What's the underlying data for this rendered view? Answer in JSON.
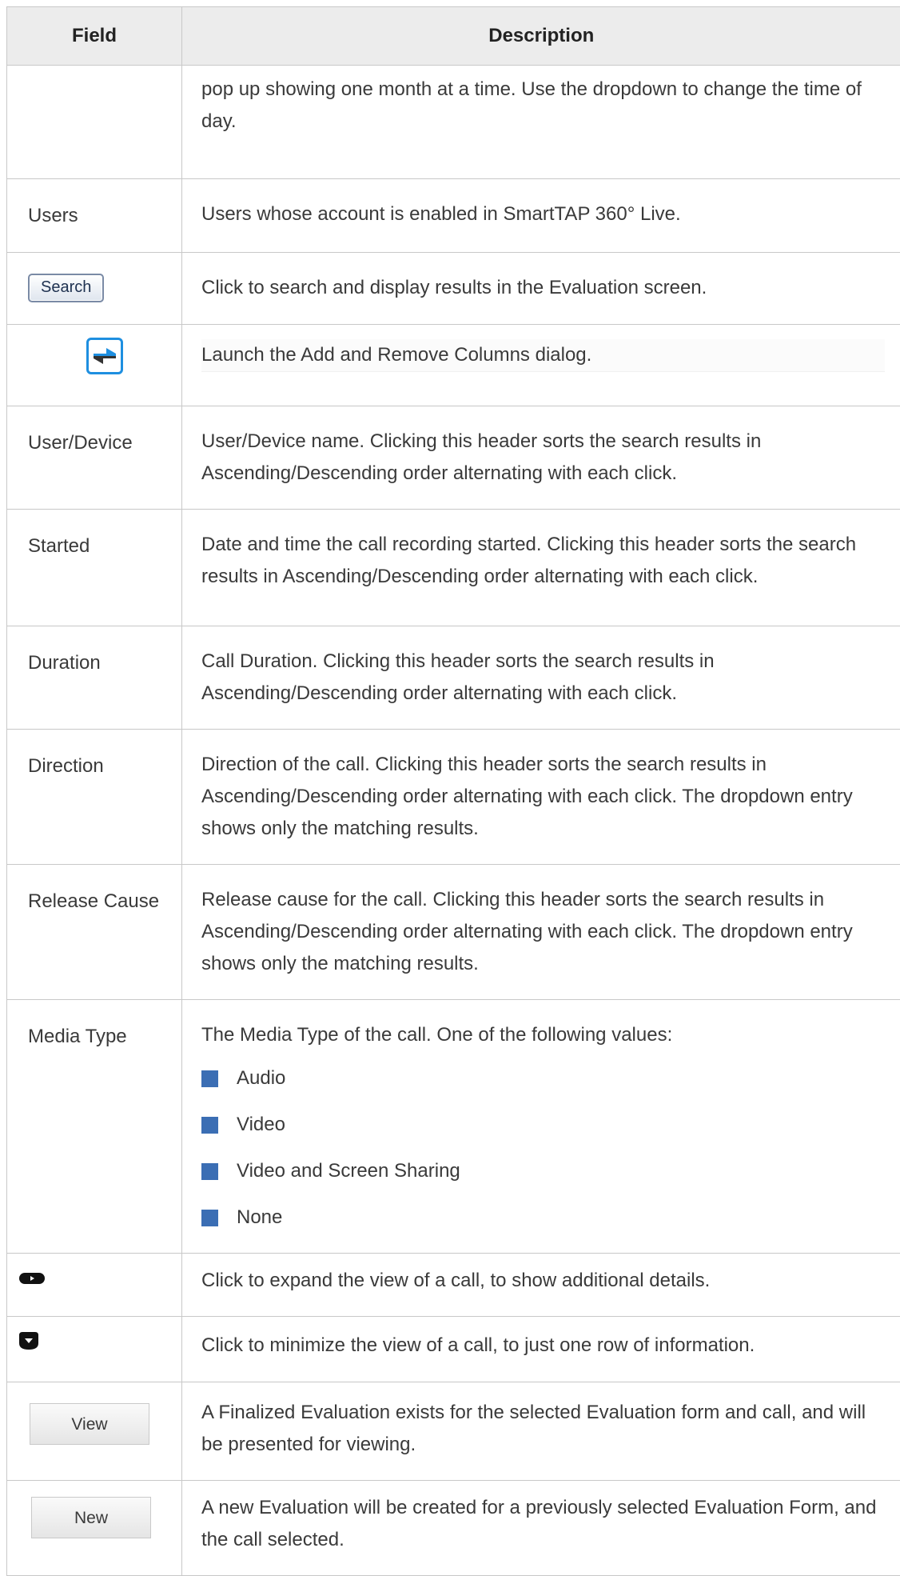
{
  "header": {
    "field": "Field",
    "description": "Description"
  },
  "rows": [
    {
      "field": "",
      "description": "pop up showing one month at a time. Use the dropdown to change the time of day."
    },
    {
      "field": "Users",
      "description": "Users whose account is enabled in SmartTAP 360° Live."
    },
    {
      "field_button": "Search",
      "description": "Click to search and display results in the Evaluation screen."
    },
    {
      "field_icon": "swap-columns-icon",
      "description": "Launch the Add and Remove Columns dialog."
    },
    {
      "field": "User/Device",
      "description": "User/Device name. Clicking this header sorts the search results in Ascending/Descending order alternating with each click."
    },
    {
      "field": "Started",
      "description": "Date and time the call recording started. Clicking this header sorts the search results in Ascending/Descending order alternating with each click."
    },
    {
      "field": "Duration",
      "description": "Call Duration. Clicking this header sorts the search results in Ascending/Descending order alternating with each click."
    },
    {
      "field": "Direction",
      "description": "Direction of the call. Clicking this header sorts the search results in Ascending/Descending order alternating with each click. The dropdown entry shows only the matching results."
    },
    {
      "field": "Release Cause",
      "description": "Release cause for the call. Clicking this header sorts the search results in Ascending/Descending order alternating with each click. The dropdown entry shows only the matching results."
    },
    {
      "field": "Media Type",
      "description": "The Media Type of the call. One of the following values:",
      "bullets": [
        "Audio",
        "Video",
        "Video and Screen Sharing",
        "None"
      ]
    },
    {
      "field_icon": "expand-icon",
      "description": "Click to expand the view of a call, to show additional details."
    },
    {
      "field_icon": "collapse-icon",
      "description": "Click to minimize the view of a call, to just one row of information."
    },
    {
      "field_button": "View",
      "description": "A Finalized Evaluation exists for the selected Evaluation form and call, and will be presented for viewing."
    },
    {
      "field_button": "New",
      "description": "A new Evaluation will be created for a previously selected Evaluation Form, and the call selected."
    }
  ],
  "colors": {
    "bullet": "#3b6eb4",
    "header_bg": "#ececec",
    "border": "#c8c8c8",
    "icon_blue": "#1e8fe0"
  }
}
